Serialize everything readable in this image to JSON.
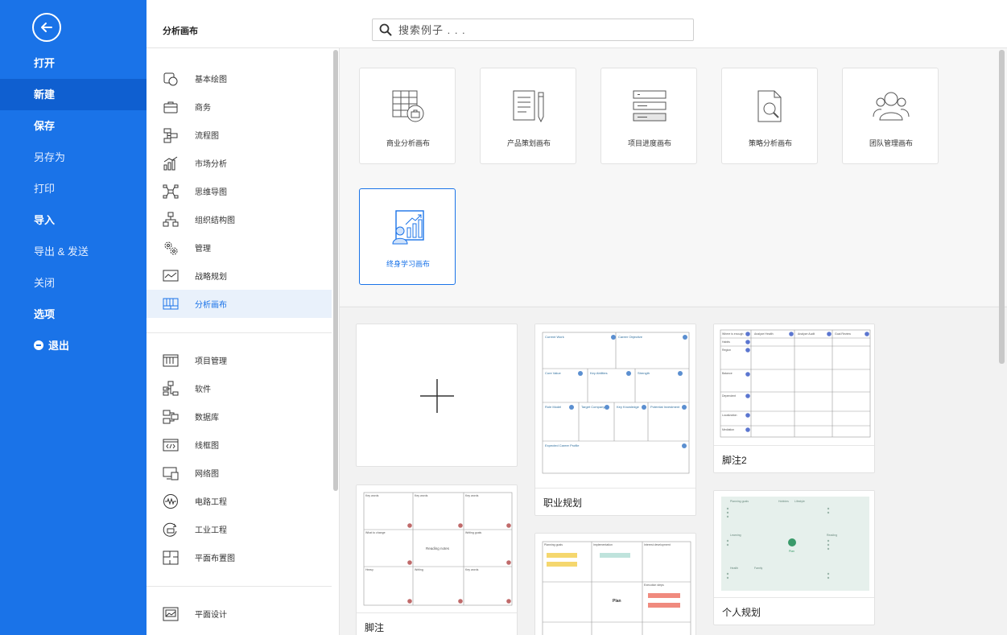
{
  "nav": {
    "items": [
      {
        "label": "打开",
        "bold": true
      },
      {
        "label": "新建",
        "active": true
      },
      {
        "label": "保存",
        "bold": true
      },
      {
        "label": "另存为"
      },
      {
        "label": "打印"
      },
      {
        "label": "导入",
        "bold": true
      },
      {
        "label": "导出 & 发送"
      },
      {
        "label": "关闭"
      },
      {
        "label": "选项",
        "bold": true
      },
      {
        "label": "退出",
        "bold": true
      }
    ]
  },
  "header": {
    "title": "分析画布",
    "search_placeholder": "搜索例子 . . ."
  },
  "categories": {
    "group1": [
      "基本绘图",
      "商务",
      "流程图",
      "市场分析",
      "思维导图",
      "组织结构图",
      "管理",
      "战略规划",
      "分析画布"
    ],
    "group2": [
      "项目管理",
      "软件",
      "数据库",
      "线框图",
      "网络图",
      "电路工程",
      "工业工程",
      "平面布置图"
    ],
    "group3": [
      "平面设计"
    ],
    "active": "分析画布"
  },
  "templates": [
    {
      "label": "商业分析画布",
      "icon": "business-analysis-icon"
    },
    {
      "label": "产品策划画布",
      "icon": "product-plan-icon"
    },
    {
      "label": "项目进度画布",
      "icon": "project-progress-icon"
    },
    {
      "label": "策略分析画布",
      "icon": "strategy-analysis-icon"
    },
    {
      "label": "团队管理画布",
      "icon": "team-management-icon"
    },
    {
      "label": "终身学习画布",
      "icon": "lifelong-learning-icon",
      "selected": true
    }
  ],
  "gallery": {
    "cards": [
      {
        "caption": ""
      },
      {
        "caption": "职业规划"
      },
      {
        "caption": "脚注2"
      },
      {
        "caption": "脚注"
      },
      {
        "caption": ""
      },
      {
        "caption": "个人规划"
      }
    ],
    "thumb_text": {
      "career": [
        "Current Work",
        "Career Objective",
        "Core Value",
        "Key Abilities",
        "Strength",
        "Role Model",
        "Target Company",
        "Key Knowledge",
        "Potential Investment",
        "Expected Career Profile"
      ],
      "footnote2_headers": [
        "Where is enough",
        "Analyze Health",
        "Analyze Audit",
        "Goal Review"
      ],
      "footnote2_rows": [
        "Habits",
        "Region",
        "Balance",
        "Dependent",
        "Localization",
        "Mediation"
      ],
      "footnote_cells": [
        "Key words",
        "Key words",
        "Key words",
        "What to change",
        "Reading notes",
        "Writing goals",
        "Heavy",
        "Writing",
        "Key words"
      ],
      "plan_labels": [
        "Planning goals",
        "Implementation",
        "Interest development",
        "Your text here",
        "Plan",
        "Execution steps"
      ],
      "personal_labels": [
        "Planning goals",
        "Hobbies",
        "Lifestyle",
        "Learning",
        "Reading",
        "Health",
        "Family",
        "Plan"
      ]
    }
  },
  "colors": {
    "nav_bg": "#1a73e8",
    "nav_active": "#0f5fd0",
    "accent": "#1a73e8",
    "card_border": "#e2e2e2"
  }
}
